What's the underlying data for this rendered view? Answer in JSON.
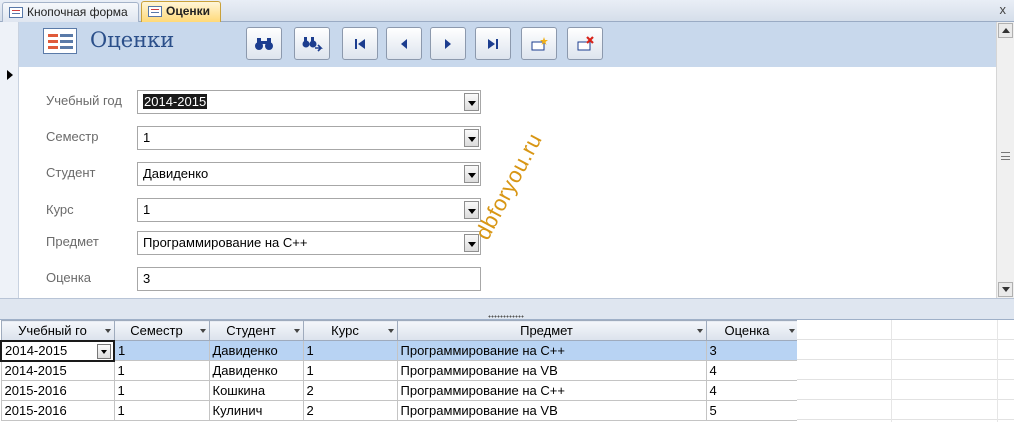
{
  "tabs": [
    {
      "label": "Кнопочная форма",
      "active": false
    },
    {
      "label": "Оценки",
      "active": true
    }
  ],
  "close_glyph": "x",
  "form": {
    "title": "Оценки",
    "icon": "form-icon",
    "nav_buttons": [
      {
        "name": "find-button",
        "icon": "binoculars-icon"
      },
      {
        "name": "find-next-button",
        "icon": "binoculars-next-icon"
      },
      {
        "name": "first-record-button",
        "icon": "first-record-icon"
      },
      {
        "name": "previous-record-button",
        "icon": "previous-record-icon"
      },
      {
        "name": "next-record-button",
        "icon": "next-record-icon"
      },
      {
        "name": "last-record-button",
        "icon": "last-record-icon"
      },
      {
        "name": "new-record-button",
        "icon": "new-record-icon"
      },
      {
        "name": "delete-record-button",
        "icon": "delete-record-icon"
      }
    ],
    "fields": {
      "year": {
        "label": "Учебный год",
        "value": "2014-2015"
      },
      "semester": {
        "label": "Семестр",
        "value": "1"
      },
      "student": {
        "label": "Студент",
        "value": "Давиденко"
      },
      "course": {
        "label": "Курс",
        "value": "1"
      },
      "subject": {
        "label": "Предмет",
        "value": "Программирование на C++"
      },
      "grade": {
        "label": "Оценка",
        "value": "3"
      }
    }
  },
  "watermark": "dbforyou.ru",
  "datasheet": {
    "columns": [
      "Учебный го",
      "Семестр",
      "Студент",
      "Курс",
      "Предмет",
      "Оценка"
    ],
    "rows": [
      [
        "2014-2015",
        "1",
        "Давиденко",
        "1",
        "Программирование на C++",
        "3"
      ],
      [
        "2014-2015",
        "1",
        "Давиденко",
        "1",
        "Программирование на VB",
        "4"
      ],
      [
        "2015-2016",
        "1",
        "Кошкина",
        "2",
        "Программирование на C++",
        "4"
      ],
      [
        "2015-2016",
        "1",
        "Кулинич",
        "2",
        "Программирование на VB",
        "5"
      ]
    ]
  },
  "colors": {
    "header_band": "#c8d8ec",
    "title": "#2b4f8a",
    "active_tab": "#ffd978",
    "selected_row": "#b8d3f3",
    "watermark": "#d89614"
  }
}
